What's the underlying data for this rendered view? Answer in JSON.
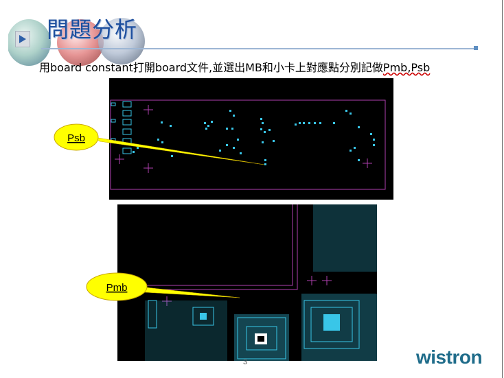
{
  "slide": {
    "title": "問題分析",
    "instruction_prefix": "用board constant打開board文件,並選出MB和小卡上對應點分別記做",
    "instruction_labels": "Pmb,Psb",
    "page_number": "3",
    "brand": "wistron"
  },
  "callouts": {
    "top": "Psb",
    "bottom": "Pmb"
  },
  "colors": {
    "title": "#1e4f9e",
    "callout_fill": "#ffff00",
    "pcb_background": "#000000",
    "pcb_outline": "#b040b0",
    "pcb_pads": "#39c6e8",
    "logo": "#1f6c8a"
  }
}
